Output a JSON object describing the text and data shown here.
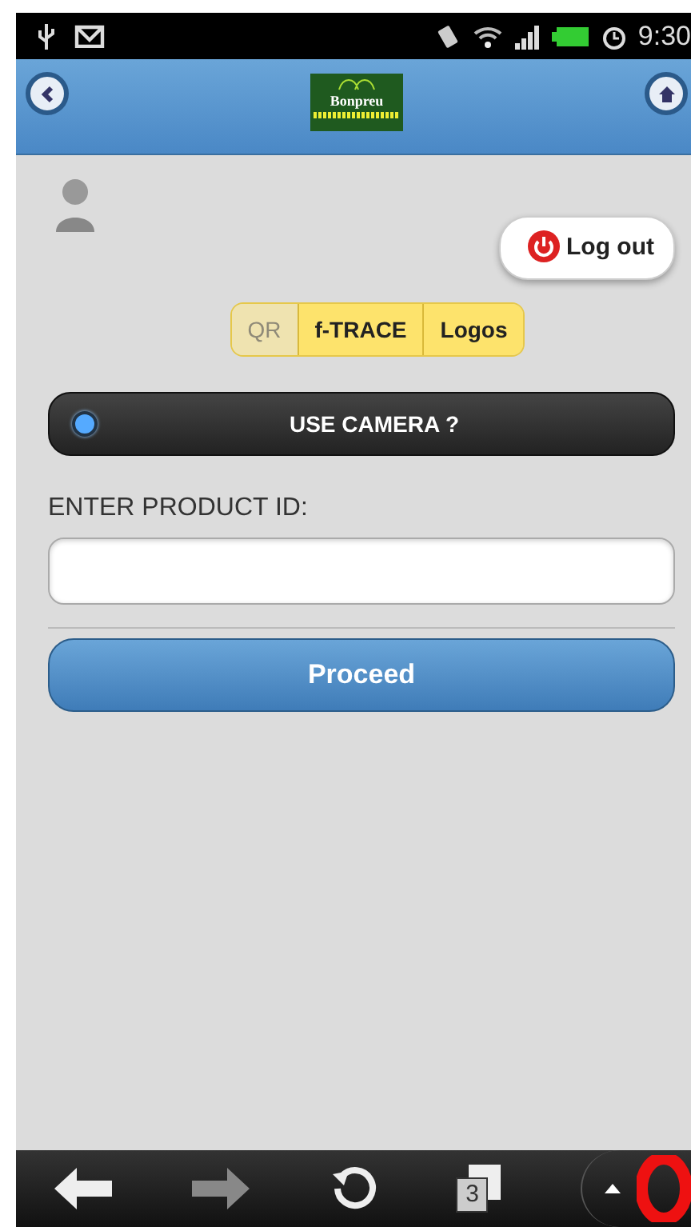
{
  "status_bar": {
    "time": "9:30"
  },
  "header": {
    "logo_text": "Bonpreu"
  },
  "logout": {
    "label": "Log out"
  },
  "modes": [
    {
      "label": "QR",
      "disabled": true
    },
    {
      "label": "f-TRACE",
      "disabled": false
    },
    {
      "label": "Logos",
      "disabled": false
    }
  ],
  "camera": {
    "label": "USE CAMERA ?",
    "on": false
  },
  "product_id": {
    "label": "ENTER PRODUCT ID:"
  },
  "proceed": {
    "label": "Proceed"
  },
  "browser_bar": {
    "tab_count": "3"
  }
}
